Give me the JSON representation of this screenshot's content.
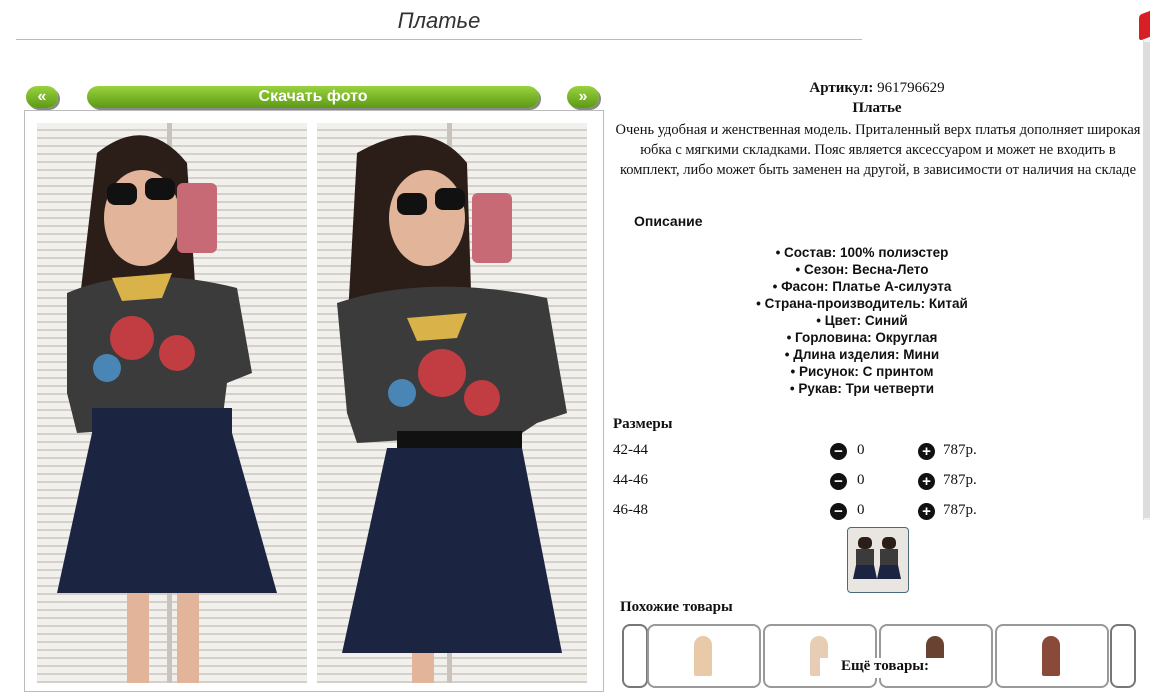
{
  "header": {
    "title": "Платье"
  },
  "nav": {
    "prev_label": "«",
    "download_label": "Скачать фото",
    "next_label": "»"
  },
  "product": {
    "sku_label": "Артикул:",
    "sku_value": "961796629",
    "name": "Платье",
    "description": "Очень удобная и женственная модель. Приталенный верх платья дополняет широкая юбка с мягкими складками. Пояс является аксессуаром и может не входить в комплект, либо может быть заменен на другой, в зависимости от наличия на складе",
    "attributes_title": "Описание",
    "attributes": [
      "Состав: 100% полиэстер",
      "Сезон: Весна-Лето",
      "Фасон: Платье А-силуэта",
      "Страна-производитель: Китай",
      "Цвет: Синий",
      "Горловина: Округлая",
      "Длина изделия: Мини",
      "Рисунок: С принтом",
      "Рукав: Три четверти"
    ]
  },
  "sizes": {
    "title": "Размеры",
    "rows": [
      {
        "size": "42-44",
        "qty": "0",
        "price": "787р."
      },
      {
        "size": "44-46",
        "qty": "0",
        "price": "787р."
      },
      {
        "size": "46-48",
        "qty": "0",
        "price": "787р."
      }
    ],
    "minus_symbol": "−",
    "plus_symbol": "+"
  },
  "similar": {
    "title": "Похожие товары",
    "more_label": "Ещё товары:"
  },
  "colors": {
    "accent_green": "#6aab1e",
    "skirt": "#1b2440",
    "top": "#3b3b3b"
  }
}
